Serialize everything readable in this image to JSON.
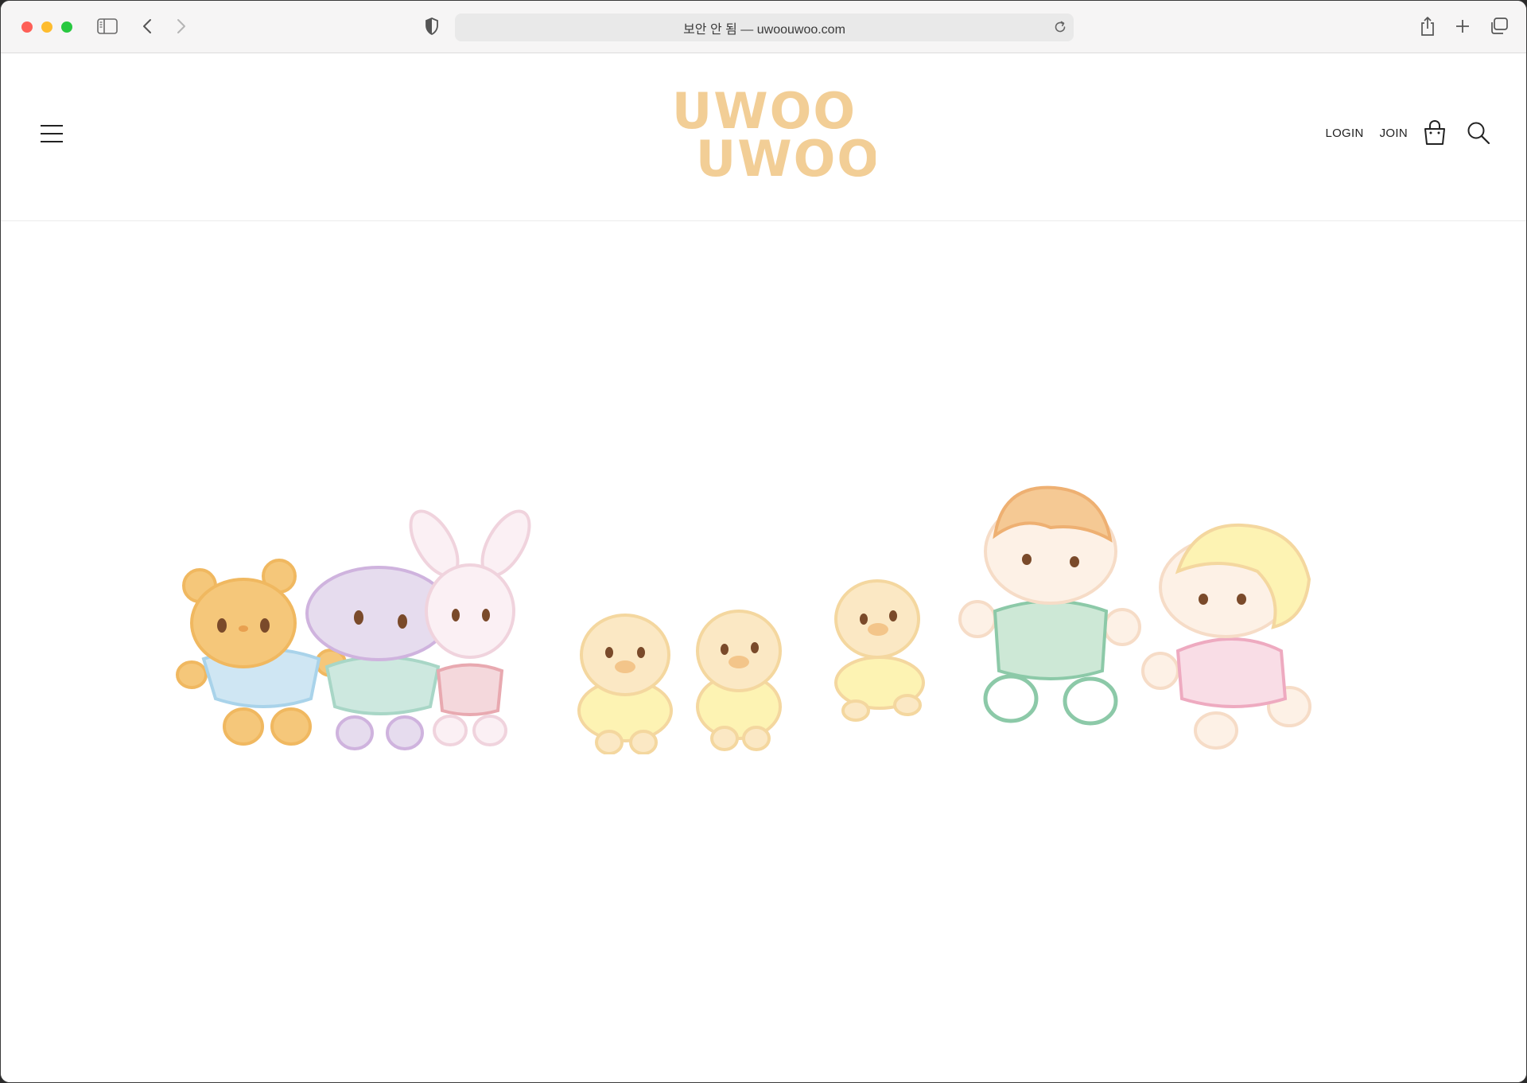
{
  "browser": {
    "url_text": "보안 안 됨 — uwoouwoo.com",
    "traffic_colors": {
      "close": "#fe5f57",
      "minimize": "#febc2e",
      "maximize": "#28c840"
    },
    "icons": [
      "sidebar-icon",
      "back-icon",
      "forward-icon",
      "shield-icon",
      "reload-icon",
      "share-icon",
      "new-tab-icon",
      "tabs-overview-icon"
    ]
  },
  "site": {
    "logo_line1": "UWOO",
    "logo_line2": "UWOO",
    "logo_color": "#f2ce96",
    "nav": {
      "login": "LOGIN",
      "join": "JOIN"
    },
    "icons": [
      "menu-icon",
      "shopping-bag-icon",
      "search-icon"
    ]
  },
  "hero": {
    "characters": [
      "bear",
      "elephant",
      "bunny",
      "chick",
      "chick",
      "chick",
      "boy",
      "girl"
    ]
  }
}
